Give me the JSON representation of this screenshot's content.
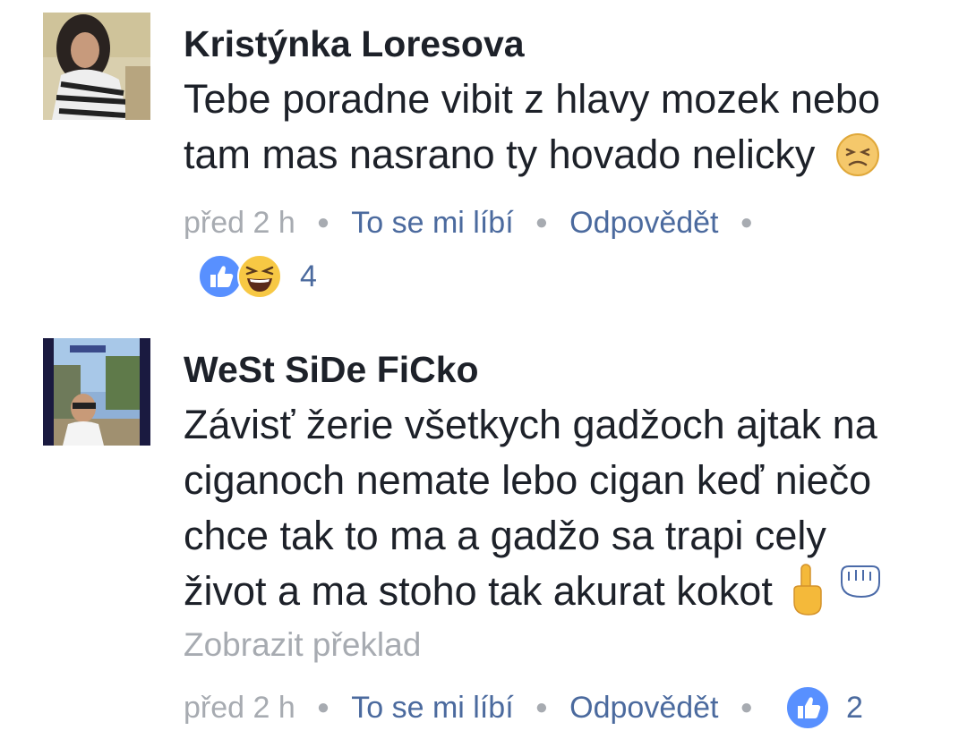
{
  "colors": {
    "author": "#1d2129",
    "text": "#1d2129",
    "meta_gray": "#a7abb1",
    "link_blue": "#4b6a9e",
    "like_blue": "#5890ff",
    "emoji_yellow": "#f5c33b"
  },
  "comments": [
    {
      "author": "Kristýnka Loresova",
      "text_lines": [
        "Tebe poradne vibit z hlavy mozek nebo",
        "tam mas nasrano ty hovado nelicky"
      ],
      "trailing_emoji": [
        "persevering-face-emoji"
      ],
      "time": "před 2 h",
      "like_label": "To se mi líbí",
      "reply_label": "Odpovědět",
      "reactions": [
        "like-icon",
        "laughing-face-icon"
      ],
      "reaction_count": "4"
    },
    {
      "author": "WeSt SiDe FiCko",
      "text_lines": [
        "Závisť žerie všetkych gadžoch ajtak na",
        "ciganoch nemate lebo cigan keď niečo",
        "chce tak to ma a gadžo sa trapi cely",
        "život a ma stoho tak akurat kokot"
      ],
      "trailing_emoji": [
        "middle-finger-emoji",
        "fist-emoji"
      ],
      "translate_label": "Zobrazit překlad",
      "time": "před 2 h",
      "like_label": "To se mi líbí",
      "reply_label": "Odpovědět",
      "reactions": [
        "like-icon"
      ],
      "reaction_count": "2"
    }
  ]
}
